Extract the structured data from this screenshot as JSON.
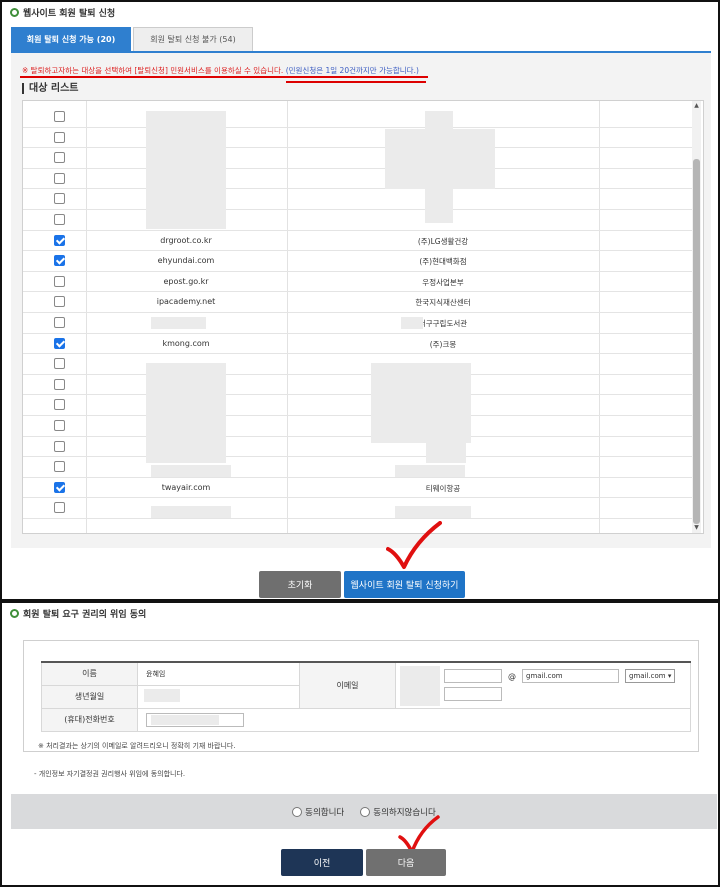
{
  "top": {
    "section_title": "웹사이트 회원 탈퇴 신청",
    "tabs": [
      {
        "label": "회원 탈퇴 신청 가능 (20)",
        "active": true
      },
      {
        "label": "회원 탈퇴 신청 불가 (54)",
        "active": false
      }
    ],
    "notice_main": "※ 탈퇴하고자하는 대상을 선택하여 [탈퇴신청] 민원서비스를 이용하실 수 있습니다.",
    "notice_limit": "(민원신청은 1일 20건까지만 가능합니다.)",
    "list_title": "대상 리스트",
    "rows": [
      {
        "checked": false,
        "domain": "",
        "company": ""
      },
      {
        "checked": false,
        "domain": "",
        "company": ""
      },
      {
        "checked": false,
        "domain": "",
        "company": ""
      },
      {
        "checked": false,
        "domain": "",
        "company": ""
      },
      {
        "checked": false,
        "domain": "",
        "company": ""
      },
      {
        "checked": false,
        "domain": "",
        "company": ""
      },
      {
        "checked": true,
        "domain": "drgroot.co.kr",
        "company": "(주)LG생활건강"
      },
      {
        "checked": true,
        "domain": "ehyundai.com",
        "company": "(주)현대백화점"
      },
      {
        "checked": false,
        "domain": "epost.go.kr",
        "company": "우정사업본부"
      },
      {
        "checked": false,
        "domain": "ipacademy.net",
        "company": "한국지식재산센터"
      },
      {
        "checked": false,
        "domain": "",
        "company": "서구구립도서관"
      },
      {
        "checked": true,
        "domain": "kmong.com",
        "company": "(주)크몽"
      },
      {
        "checked": false,
        "domain": "",
        "company": ""
      },
      {
        "checked": false,
        "domain": "",
        "company": ""
      },
      {
        "checked": false,
        "domain": "",
        "company": ""
      },
      {
        "checked": false,
        "domain": "",
        "company": ""
      },
      {
        "checked": false,
        "domain": "",
        "company": ""
      },
      {
        "checked": false,
        "domain": "",
        "company": ""
      },
      {
        "checked": true,
        "domain": "twayair.com",
        "company": "티웨이항공"
      },
      {
        "checked": false,
        "domain": "",
        "company": ""
      }
    ],
    "reset_label": "초기화",
    "apply_label": "웹사이트 회원 탈퇴 신청하기"
  },
  "bottom": {
    "section_title": "회원 탈퇴 요구 권리의 위임 동의",
    "name_label": "이름",
    "name_value": "윤혜임",
    "birth_label": "생년월일",
    "email_label": "이메일",
    "email_at": "@",
    "email_domain_value": "gmail.com",
    "email_select_value": "gmail.com",
    "phone_label": "(휴대)전화번호",
    "result_note": "※ 처리결과는 상기의 이메일로 알려드리오니 정확히 기재 바랍니다.",
    "delegation_note": "- 개인정보 자기결정권 권리행사 위임에 동의합니다.",
    "agree_label": "동의합니다",
    "disagree_label": "동의하지않습니다",
    "prev_label": "이전",
    "next_label": "다음"
  },
  "colors": {
    "accent_blue": "#2f7fcf",
    "check_blue": "#1a73e8",
    "annotation_red": "#d00000",
    "navy_button": "#1e3556"
  }
}
